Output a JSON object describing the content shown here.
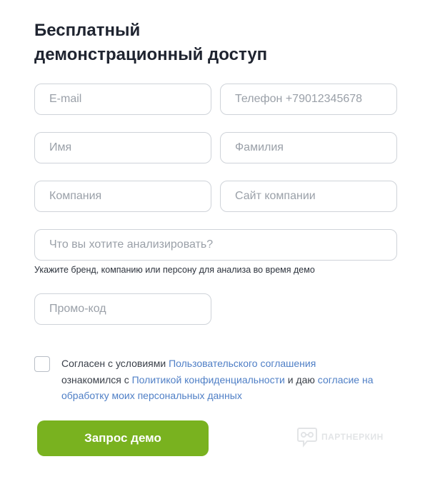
{
  "title": {
    "line1": "Бесплатный",
    "line2": "демонстрационный доступ"
  },
  "fields": {
    "email": {
      "placeholder": "E-mail",
      "value": ""
    },
    "phone": {
      "placeholder": "Телефон +79012345678",
      "value": ""
    },
    "first_name": {
      "placeholder": "Имя",
      "value": ""
    },
    "last_name": {
      "placeholder": "Фамилия",
      "value": ""
    },
    "company": {
      "placeholder": "Компания",
      "value": ""
    },
    "company_site": {
      "placeholder": "Сайт компании",
      "value": ""
    },
    "analyze": {
      "placeholder": "Что вы хотите анализировать?",
      "value": ""
    },
    "promo": {
      "placeholder": "Промо-код",
      "value": ""
    }
  },
  "analyze_hint": "Укажите бренд, компанию или персону для анализа во время демо",
  "consent": {
    "checked": false,
    "text1": "Согласен с условиями ",
    "link1": "Пользовательского соглашения",
    "text2": "ознакомился с ",
    "link2": "Политикой конфиденциальности",
    "text3": " и даю ",
    "link3": "согласие на обработку моих персональных данных"
  },
  "submit_label": "Запрос демо",
  "watermark": {
    "icon": "chat-bubble-glasses-icon",
    "text": "ПАРТНЕРКИН"
  },
  "colors": {
    "primary_button": "#79b21f",
    "link": "#4f7fc6",
    "border": "#cfd3d9",
    "title": "#1f2430"
  }
}
